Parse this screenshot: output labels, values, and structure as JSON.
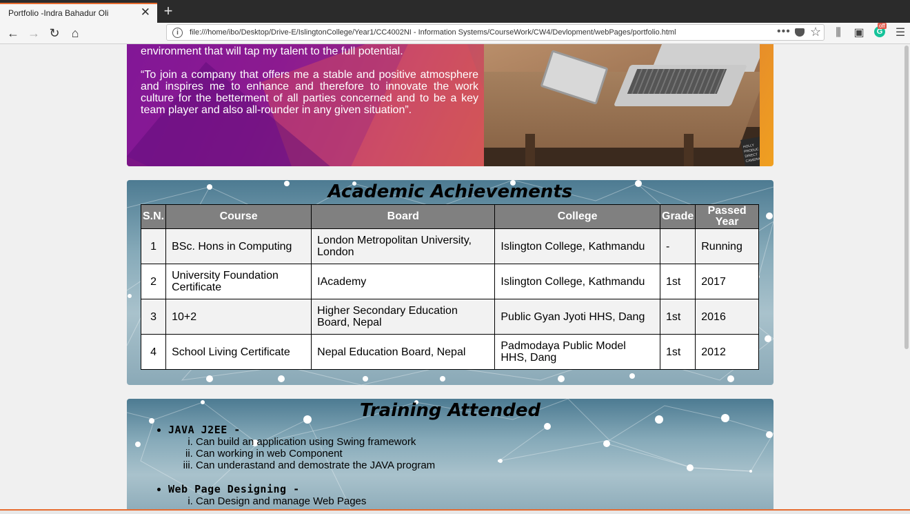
{
  "browser": {
    "tab_title": "Portfolio -Indra Bahadur Oli",
    "tab_close": "✕",
    "new_tab": "+",
    "url": "file:///home/ibo/Desktop/Drive-E/IslingtonCollege/Year1/CC4002NI - Information Systems/CourseWork/CW4/Devlopment/webPages/portfolio.html",
    "url_more": "•••",
    "grammarly_badge": "off",
    "icons": [
      "back-icon",
      "forward-icon",
      "reload-icon",
      "home-icon",
      "info-icon",
      "pocket-icon",
      "bookmark-star-icon",
      "library-icon",
      "sidebar-icon",
      "grammarly-icon",
      "menu-icon"
    ]
  },
  "hero": {
    "paragraph1": "environment that will tap my talent to the full potential.",
    "paragraph2": "“To join a company that offers me a stable and positive atmosphere and inspires me to enhance and therefore to innovate the work culture for the betterment of all parties concerned and to be a key team player and also all-rounder in any given situation”.",
    "book_text": "HOLLY PRODUC DIRECT CAMERA DATE"
  },
  "achievements": {
    "title": "Academic Achievements",
    "headers": [
      "S.N.",
      "Course",
      "Board",
      "College",
      "Grade",
      "Passed Year"
    ],
    "rows": [
      [
        "1",
        "BSc. Hons in Computing",
        "London Metropolitan University, London",
        "Islington College, Kathmandu",
        "-",
        "Running"
      ],
      [
        "2",
        "University Foundation Certificate",
        "IAcademy",
        "Islington College, Kathmandu",
        "1st",
        "2017"
      ],
      [
        "3",
        "10+2",
        "Higher Secondary Education Board, Nepal",
        "Public Gyan Jyoti HHS, Dang",
        "1st",
        "2016"
      ],
      [
        "4",
        "School Living Certificate",
        "Nepal Education Board, Nepal",
        "Padmodaya Public Model HHS, Dang",
        "1st",
        "2012"
      ]
    ]
  },
  "training": {
    "title": "Training Attended",
    "items": [
      {
        "name": "JAVA J2EE -",
        "points": [
          "Can build an application using Swing framework",
          "Can working in web Component",
          "Can underastand and demostrate the JAVA program"
        ]
      },
      {
        "name": "Web Page Designing -",
        "points": [
          "Can Design and manage Web Pages"
        ]
      }
    ]
  }
}
